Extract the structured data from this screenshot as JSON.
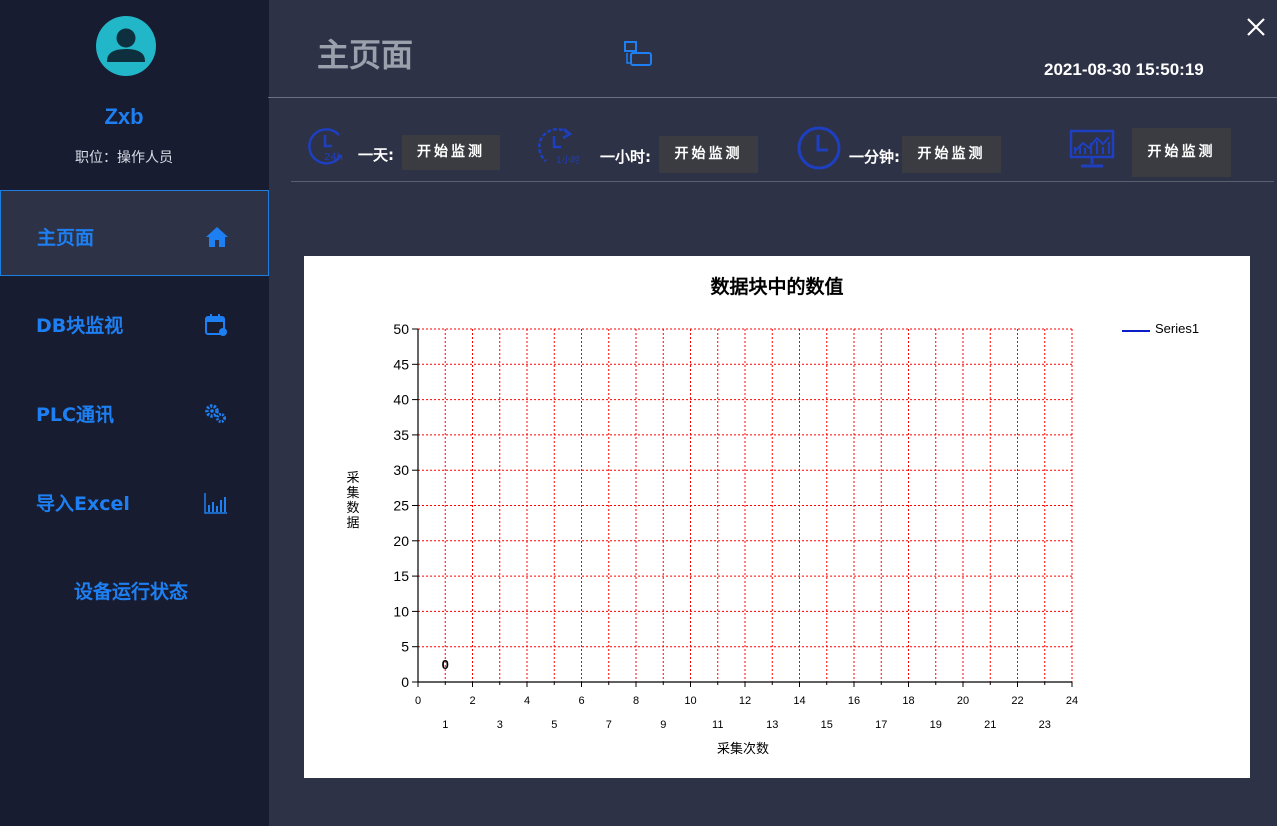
{
  "user": {
    "name": "Zxb",
    "role": "职位：操作人员"
  },
  "sidebar": {
    "items": [
      {
        "label": "主页面",
        "icon": "home-icon"
      },
      {
        "label": "DB块监视",
        "icon": "calendar-icon"
      },
      {
        "label": "PLC通讯",
        "icon": "gears-icon"
      },
      {
        "label": "导入Excel",
        "icon": "bar-chart-icon"
      },
      {
        "label": "设备运行状态",
        "icon": ""
      }
    ]
  },
  "header": {
    "title": "主页面",
    "datetime": "2021-08-30 15:50:19"
  },
  "toolbar": {
    "day_label": "一天:",
    "hour_label": "一小时:",
    "minute_label": "一分钟:",
    "btn_label": "开始监测",
    "day_icon_text": "24h",
    "hour_icon_text": "1小时"
  },
  "colors": {
    "accent": "#1e7ff2",
    "sidebar_bg": "#171c30",
    "main_bg": "#2d3246",
    "grid": "#ff0000",
    "series": "#0a1fc4"
  },
  "chart_data": {
    "type": "line",
    "title": "数据块中的数值",
    "xlabel": "采集次数",
    "ylabel": "采集数据",
    "xlim": [
      0,
      24
    ],
    "ylim": [
      0,
      50
    ],
    "grid": true,
    "legend_position": "top-right",
    "series": [
      {
        "name": "Series1",
        "x": [
          1
        ],
        "y": [
          0
        ],
        "labels": [
          "0"
        ]
      }
    ]
  }
}
